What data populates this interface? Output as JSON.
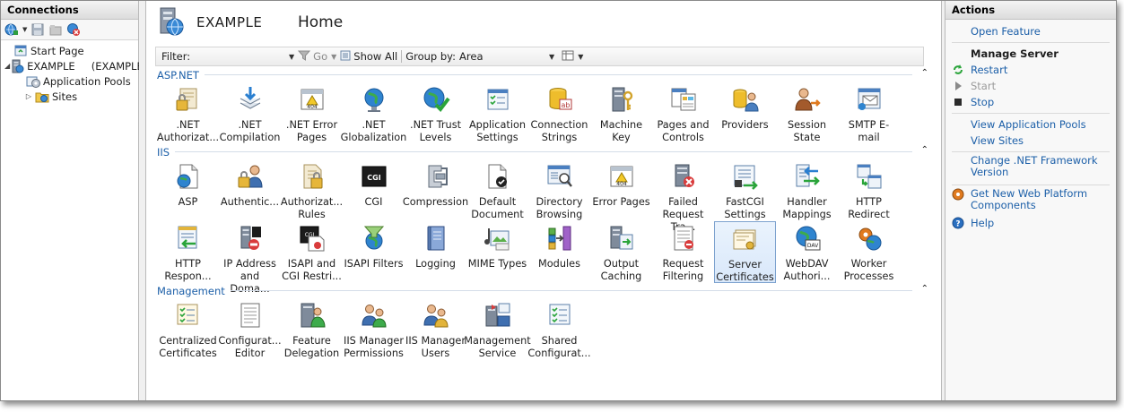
{
  "connections": {
    "header": "Connections",
    "tree": {
      "start_page": "Start Page",
      "server": "EXAMPLE",
      "server_suffix": "(EXAMPLE",
      "app_pools": "Application Pools",
      "sites": "Sites"
    }
  },
  "main": {
    "server_name": "EXAMPLE",
    "page_title": "Home",
    "filter_label": "Filter:",
    "go_label": "Go",
    "show_all_label": "Show All",
    "group_by_label": "Group by:",
    "group_by_value": "Area"
  },
  "groups": [
    {
      "name": "ASP.NET",
      "rows": [
        [
          {
            "l1": ".NET",
            "l2": "Authorizat...",
            "icon": "lock-folder-icon"
          },
          {
            "l1": ".NET",
            "l2": "Compilation",
            "icon": "stack-arrow-icon"
          },
          {
            "l1": ".NET Error",
            "l2": "Pages",
            "icon": "error-404-icon"
          },
          {
            "l1": ".NET",
            "l2": "Globalization",
            "icon": "globe-icon"
          },
          {
            "l1": ".NET Trust",
            "l2": "Levels",
            "icon": "globe-check-icon"
          },
          {
            "l1": "Application",
            "l2": "Settings",
            "icon": "checklist-icon"
          },
          {
            "l1": "Connection",
            "l2": "Strings",
            "icon": "database-ab-icon"
          },
          {
            "l1": "Machine Key",
            "l2": "",
            "icon": "server-key-icon"
          },
          {
            "l1": "Pages and",
            "l2": "Controls",
            "icon": "pages-icon"
          },
          {
            "l1": "Providers",
            "l2": "",
            "icon": "people-db-icon"
          },
          {
            "l1": "Session State",
            "l2": "",
            "icon": "person-arrows-icon"
          },
          {
            "l1": "SMTP E-mail",
            "l2": "",
            "icon": "email-window-icon"
          }
        ]
      ]
    },
    {
      "name": "IIS",
      "rows": [
        [
          {
            "l1": "ASP",
            "l2": "",
            "icon": "asp-page-icon"
          },
          {
            "l1": "Authentic...",
            "l2": "",
            "icon": "lock-person-icon"
          },
          {
            "l1": "Authorizat...",
            "l2": "Rules",
            "icon": "lock-doc-icon"
          },
          {
            "l1": "CGI",
            "l2": "",
            "icon": "cgi-icon"
          },
          {
            "l1": "Compression",
            "l2": "",
            "icon": "clamp-icon"
          },
          {
            "l1": "Default",
            "l2": "Document",
            "icon": "default-doc-icon"
          },
          {
            "l1": "Directory",
            "l2": "Browsing",
            "icon": "browse-magnifier-icon"
          },
          {
            "l1": "Error Pages",
            "l2": "",
            "icon": "error-404-icon"
          },
          {
            "l1": "Failed",
            "l2": "Request Tra...",
            "icon": "failed-request-icon"
          },
          {
            "l1": "FastCGI",
            "l2": "Settings",
            "icon": "fastcgi-icon"
          },
          {
            "l1": "Handler",
            "l2": "Mappings",
            "icon": "handler-arrows-icon"
          },
          {
            "l1": "HTTP",
            "l2": "Redirect",
            "icon": "redirect-icon"
          }
        ],
        [
          {
            "l1": "HTTP",
            "l2": "Respon...",
            "icon": "http-response-icon"
          },
          {
            "l1": "IP Address",
            "l2": "and Doma...",
            "icon": "ip-block-icon"
          },
          {
            "l1": "ISAPI and",
            "l2": "CGI Restri...",
            "icon": "isapi-cgi-icon"
          },
          {
            "l1": "ISAPI Filters",
            "l2": "",
            "icon": "funnel-globe-icon"
          },
          {
            "l1": "Logging",
            "l2": "",
            "icon": "notebook-icon"
          },
          {
            "l1": "MIME Types",
            "l2": "",
            "icon": "media-icon"
          },
          {
            "l1": "Modules",
            "l2": "",
            "icon": "modules-icon"
          },
          {
            "l1": "Output",
            "l2": "Caching",
            "icon": "cache-server-icon"
          },
          {
            "l1": "Request",
            "l2": "Filtering",
            "icon": "request-filter-icon"
          },
          {
            "l1": "Server",
            "l2": "Certificates",
            "icon": "certificates-icon",
            "selected": true
          },
          {
            "l1": "WebDAV",
            "l2": "Authori...",
            "icon": "webdav-icon"
          },
          {
            "l1": "Worker",
            "l2": "Processes",
            "icon": "worker-gears-icon"
          }
        ]
      ]
    },
    {
      "name": "Management",
      "rows": [
        [
          {
            "l1": "Centralized",
            "l2": "Certificates",
            "icon": "central-certs-icon"
          },
          {
            "l1": "Configurat...",
            "l2": "Editor",
            "icon": "config-editor-icon"
          },
          {
            "l1": "Feature",
            "l2": "Delegation",
            "icon": "delegation-icon"
          },
          {
            "l1": "IIS Manager",
            "l2": "Permissions",
            "icon": "manager-perms-icon"
          },
          {
            "l1": "IIS Manager",
            "l2": "Users",
            "icon": "manager-users-icon"
          },
          {
            "l1": "Management",
            "l2": "Service",
            "icon": "mgmt-service-icon"
          },
          {
            "l1": "Shared",
            "l2": "Configurat...",
            "icon": "shared-config-icon"
          }
        ]
      ]
    }
  ],
  "actions": {
    "header": "Actions",
    "items": [
      {
        "type": "link",
        "text": "Open Feature",
        "icon": ""
      },
      {
        "type": "sep"
      },
      {
        "type": "hdr",
        "text": "Manage Server",
        "icon": ""
      },
      {
        "type": "link",
        "text": "Restart",
        "icon": "restart-icon"
      },
      {
        "type": "dis",
        "text": "Start",
        "icon": "start-icon"
      },
      {
        "type": "link",
        "text": "Stop",
        "icon": "stop-icon"
      },
      {
        "type": "sep"
      },
      {
        "type": "link",
        "text": "View Application Pools",
        "icon": ""
      },
      {
        "type": "link",
        "text": "View Sites",
        "icon": ""
      },
      {
        "type": "sep"
      },
      {
        "type": "link2",
        "text": "Change .NET Framework",
        "text2": "Version",
        "icon": ""
      },
      {
        "type": "sep"
      },
      {
        "type": "link2",
        "text": "Get New Web Platform",
        "text2": "Components",
        "icon": "web-platform-icon"
      },
      {
        "type": "link",
        "text": "Help",
        "icon": "help-icon"
      }
    ]
  },
  "colors": {
    "accent": "#1c5fa8",
    "selection": "#d9e8fa"
  }
}
